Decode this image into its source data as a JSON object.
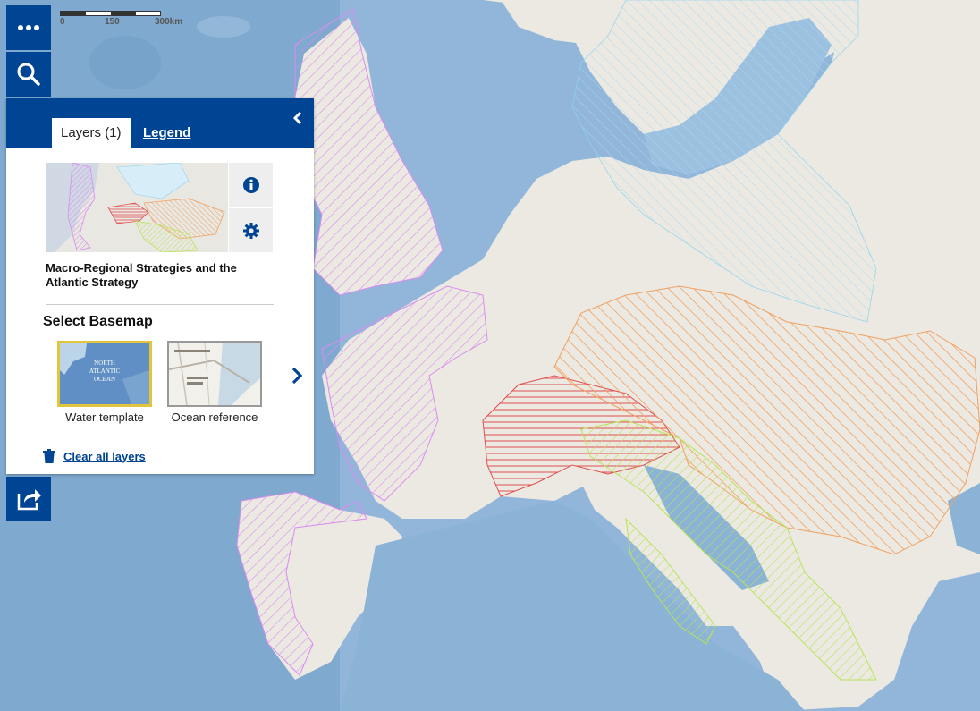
{
  "map": {
    "scale": {
      "labels": [
        "0",
        "150",
        "300km"
      ]
    }
  },
  "toolbar": {
    "more_icon": "dots-icon",
    "search_icon": "search-icon",
    "share_icon": "share-icon"
  },
  "panel": {
    "tabs": [
      {
        "label": "Layers (1)",
        "active": true
      },
      {
        "label": "Legend",
        "active": false
      }
    ],
    "layer": {
      "title": "Macro-Regional Strategies and the Atlantic Strategy",
      "info_icon": "info-icon",
      "settings_icon": "gear-icon"
    },
    "basemap": {
      "heading": "Select Basemap",
      "options": [
        {
          "label": "Water template",
          "selected": true
        },
        {
          "label": "Ocean reference",
          "selected": false
        }
      ]
    },
    "clear_label": "Clear all layers"
  },
  "colors": {
    "brand": "#004494",
    "sea": "#7fa9cf",
    "land": "#ece9e2",
    "atlantic": "#d98cf0",
    "alpine": "#e05050",
    "danube": "#f0a060",
    "adriatic": "#b9e35a",
    "baltic": "#8fd3ee"
  }
}
